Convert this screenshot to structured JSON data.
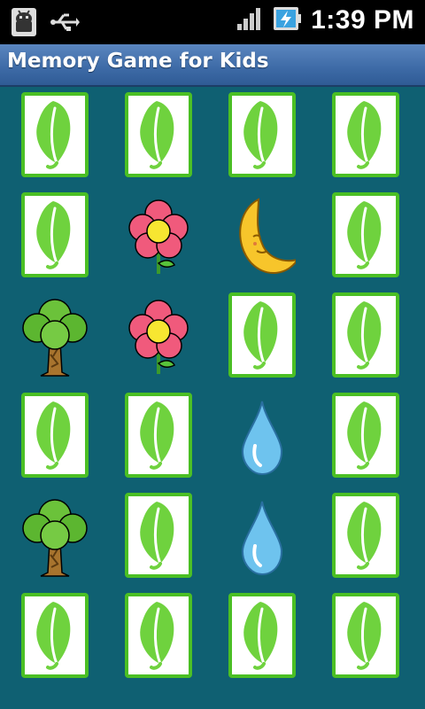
{
  "status_bar": {
    "time": "1:39 PM",
    "icons": [
      "android-debug-icon",
      "usb-icon",
      "signal-icon",
      "battery-charging-icon"
    ]
  },
  "app": {
    "title": "Memory Game for Kids"
  },
  "board": {
    "rows": 6,
    "cols": 4,
    "cards": [
      [
        "leaf-back",
        "leaf-back",
        "leaf-back",
        "leaf-back"
      ],
      [
        "leaf-back",
        "flower",
        "moon",
        "leaf-back"
      ],
      [
        "tree",
        "flower",
        "leaf-back",
        "leaf-back"
      ],
      [
        "leaf-back",
        "leaf-back",
        "drop",
        "leaf-back"
      ],
      [
        "tree",
        "leaf-back",
        "drop",
        "leaf-back"
      ],
      [
        "leaf-back",
        "leaf-back",
        "leaf-back",
        "leaf-back"
      ]
    ]
  },
  "colors": {
    "background": "#0f6072",
    "card_border": "#4bbf24",
    "leaf": "#6fd23e",
    "title_bar": "#3d6aa6"
  }
}
